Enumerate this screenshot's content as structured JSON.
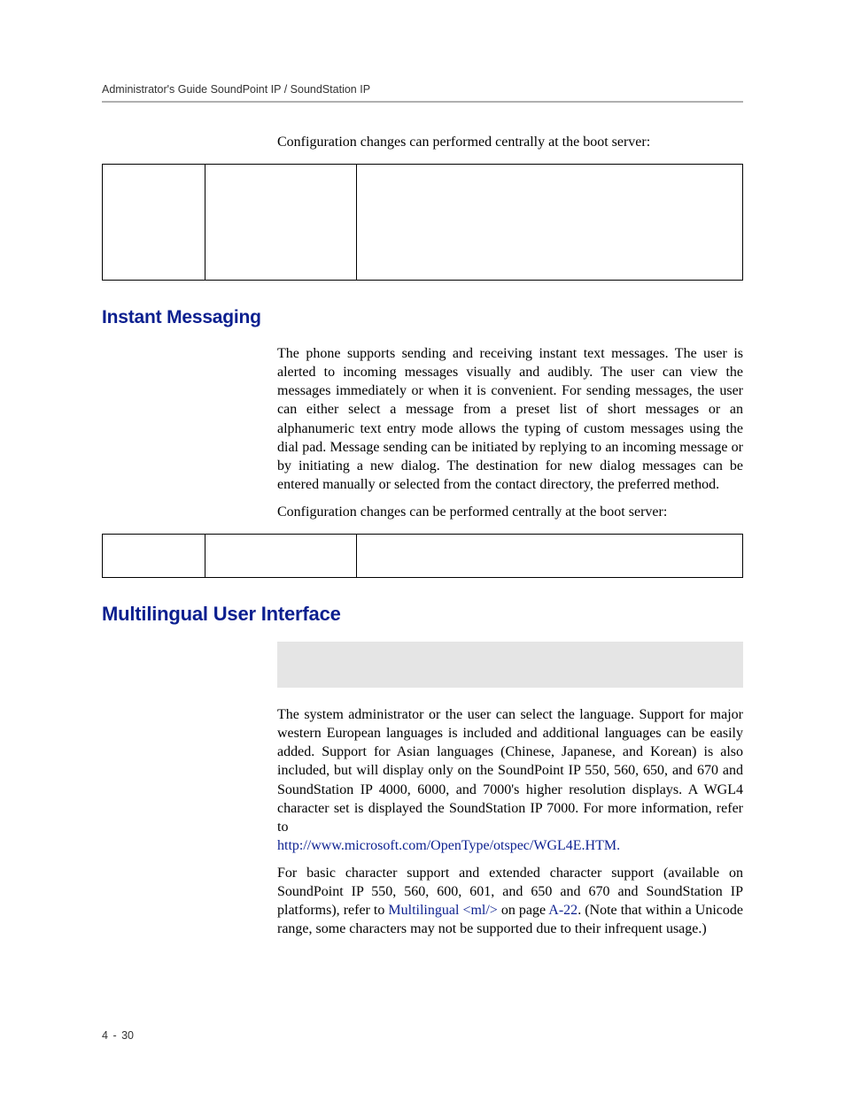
{
  "header": {
    "running": "Administrator's Guide SoundPoint IP / SoundStation IP"
  },
  "section1": {
    "intro": "Configuration changes can performed centrally at the boot server:",
    "table": {
      "col1": "",
      "col2": "",
      "col3": ""
    }
  },
  "im": {
    "heading": "Instant Messaging",
    "p1": "The phone supports sending and receiving instant text messages. The user is alerted to incoming messages visually and audibly. The user can view the messages immediately or when it is convenient. For sending messages, the user can either select a message from a preset list of short messages or an alphanumeric text entry mode allows the typing of custom messages using the dial pad. Message sending can be initiated by replying to an incoming message or by initiating a new dialog. The destination for new dialog messages can be entered manually or selected from the contact directory, the preferred method.",
    "p2": "Configuration changes can be performed centrally at the boot server:",
    "table": {
      "col1": "",
      "col2": "",
      "col3": ""
    }
  },
  "mui": {
    "heading": "Multilingual User Interface",
    "p1_pre": "The system administrator or the user can select the language. Support for major western European languages is included and additional languages can be easily added. Support for Asian languages (Chinese, Japanese, and Korean) is also included, but will display only on the SoundPoint IP 550, 560, 650, and 670 and SoundStation IP 4000, 6000, and 7000's higher resolution displays. A WGL4 character set is displayed the SoundStation IP 7000. For more information, refer to ",
    "p1_link": "http://www.microsoft.com/OpenType/otspec/WGL4E.HTM.",
    "p2_pre": "For basic character support and extended character support (available on SoundPoint IP 550, 560, 600, 601, and 650 and 670 and SoundStation IP platforms), refer to ",
    "p2_link1": "Multilingual <ml/>",
    "p2_mid": " on page ",
    "p2_link2": "A-22",
    "p2_post": ". (Note that within a Unicode range, some characters may not be supported due to their infrequent usage.)"
  },
  "footer": {
    "chapter": "4",
    "dash": "-",
    "page": "30"
  }
}
